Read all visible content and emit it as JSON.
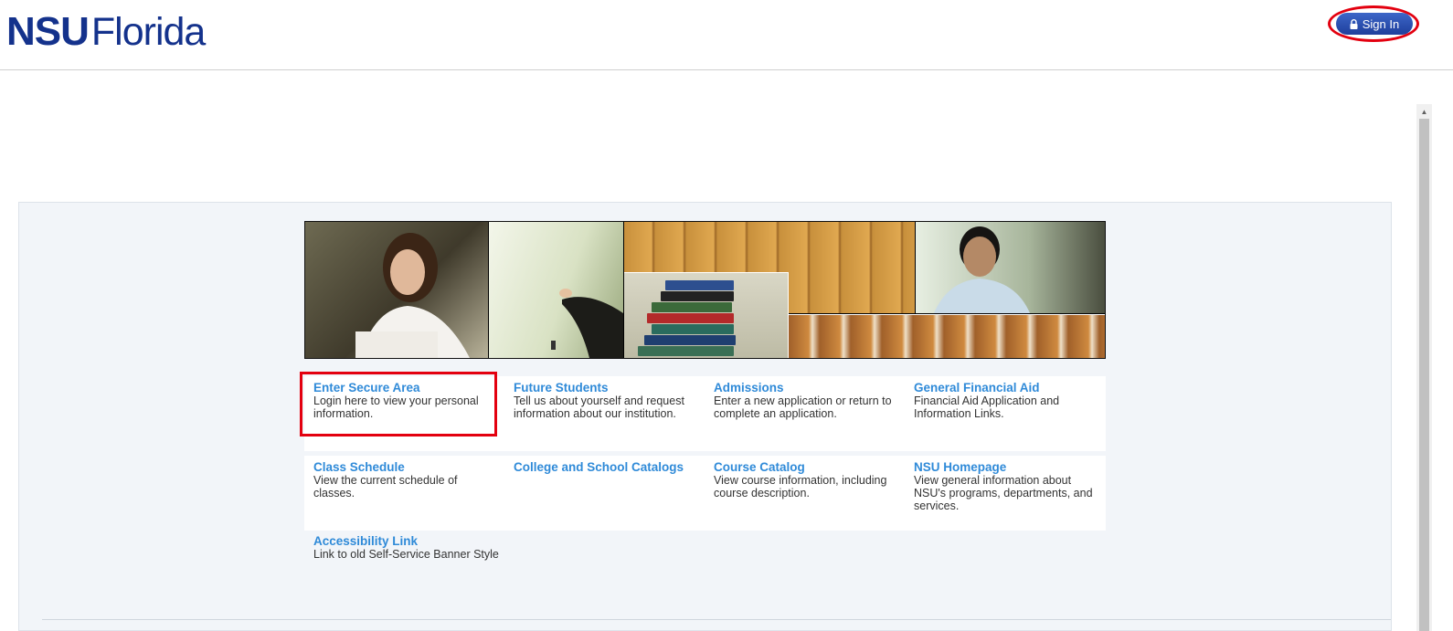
{
  "header": {
    "logo_bold": "NSU",
    "logo_light": "Florida",
    "signin_label": "Sign In"
  },
  "links": [
    {
      "title": "Enter Secure Area",
      "desc": "Login here to view your personal information."
    },
    {
      "title": "Future Students",
      "desc": "Tell us about yourself and request information about our institution."
    },
    {
      "title": "Admissions",
      "desc": "Enter a new application or return to complete an application."
    },
    {
      "title": "General Financial Aid",
      "desc": "Financial Aid Application and Information Links."
    },
    {
      "title": "Class Schedule",
      "desc": "View the current schedule of classes."
    },
    {
      "title": "College and School Catalogs",
      "desc": ""
    },
    {
      "title": "Course Catalog",
      "desc": "View course information, including course description."
    },
    {
      "title": "NSU Homepage",
      "desc": "View general information about NSU's programs, departments, and services."
    },
    {
      "title": "Accessibility Link",
      "desc": "Link to old Self-Service Banner Style"
    }
  ],
  "colors": {
    "brand": "#14328c",
    "link": "#2f8ad8",
    "annotation": "#e3000f"
  },
  "icons": {
    "signin": "lock-icon"
  }
}
